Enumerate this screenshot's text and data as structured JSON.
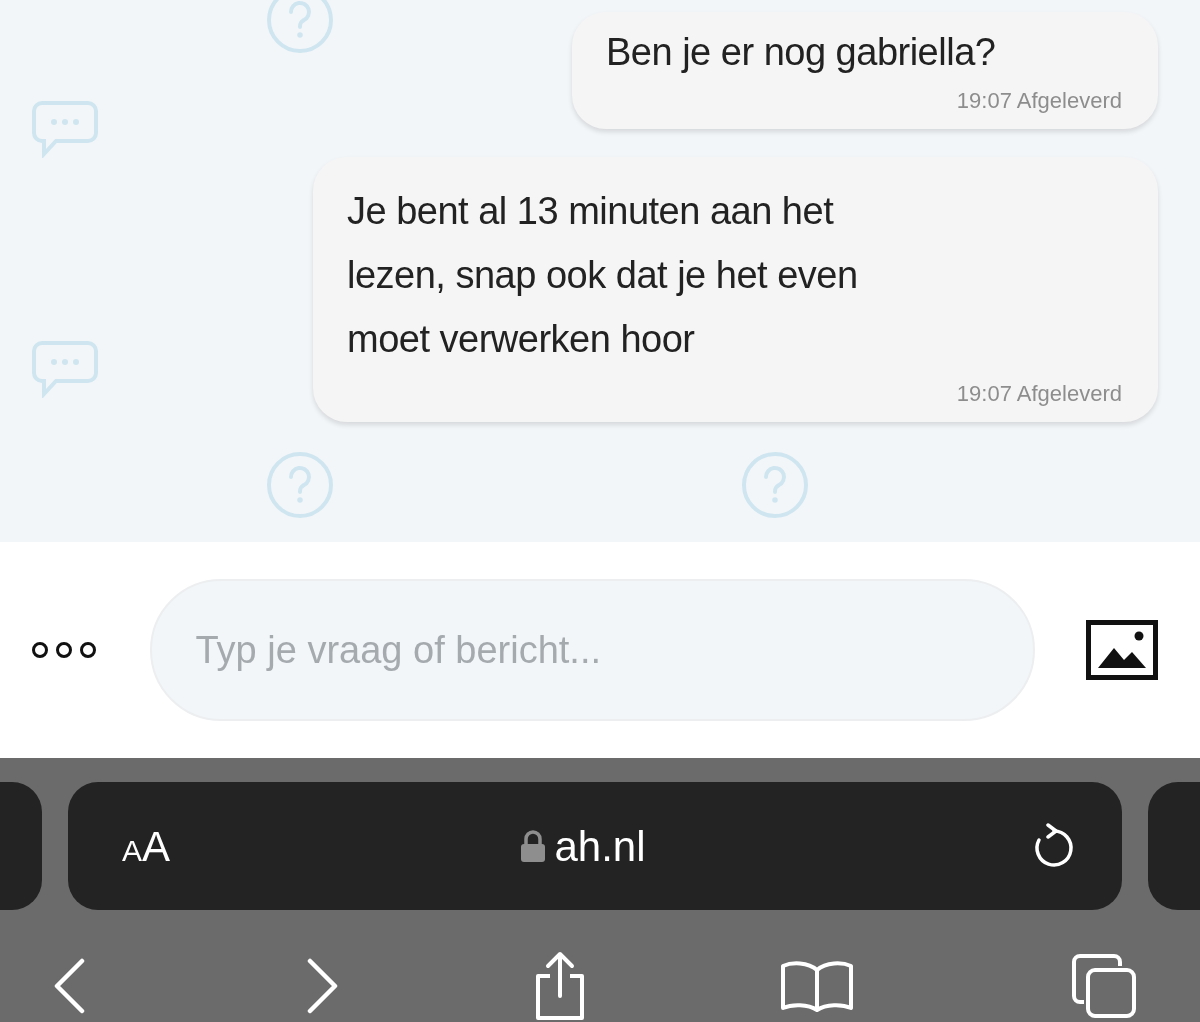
{
  "messages": [
    {
      "text": "Ben je er nog gabriella?",
      "time": "19:07 Afgeleverd"
    },
    {
      "text": "Je bent al 13 minuten aan het lezen, snap ook dat je het even moet verwerken hoor",
      "time": "19:07 Afgeleverd"
    }
  ],
  "composer": {
    "placeholder": "Typ je vraag of bericht..."
  },
  "browser": {
    "text_size_label": "AA",
    "url": "ah.nl"
  }
}
